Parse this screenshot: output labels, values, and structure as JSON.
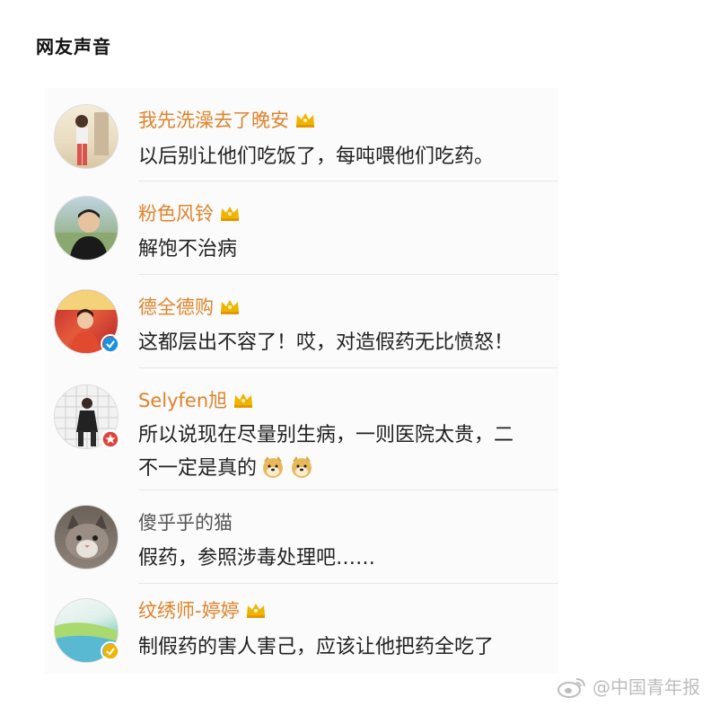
{
  "page_title": "网友声音",
  "comments": [
    {
      "username": "我先洗澡去了晚安",
      "text": "以后别让他们吃饭了，每吨喂他们吃药。",
      "crown": true,
      "verified": null
    },
    {
      "username": "粉色风铃",
      "text": "解饱不治病",
      "crown": true,
      "verified": null
    },
    {
      "username": "德全德购",
      "text": "这都层出不容了！哎，对造假药无比愤怒！",
      "crown": true,
      "verified": "blue"
    },
    {
      "username": "Selyfen旭",
      "text": "所以说现在尽量别生病，一则医院太贵，二",
      "text2": "不一定是真的",
      "crown": true,
      "verified": "red"
    },
    {
      "username": "傻乎乎的猫",
      "text": "假药，参照涉毒处理吧……",
      "crown": false,
      "verified": null
    },
    {
      "username": "纹绣师-婷婷",
      "text": "制假药的害人害己，应该让他把药全吃了",
      "crown": true,
      "verified": "yellow"
    }
  ],
  "watermark": "@中国青年报",
  "colors": {
    "username": "#e0832a",
    "username_plain": "#555555",
    "crown": "#f0b400",
    "verified_blue": "#1e90e0",
    "verified_red": "#e0413a",
    "verified_yellow": "#f0b400"
  },
  "icons": [
    "crown-icon",
    "verified-badge-icon",
    "doge-emoji-icon",
    "weibo-icon"
  ]
}
